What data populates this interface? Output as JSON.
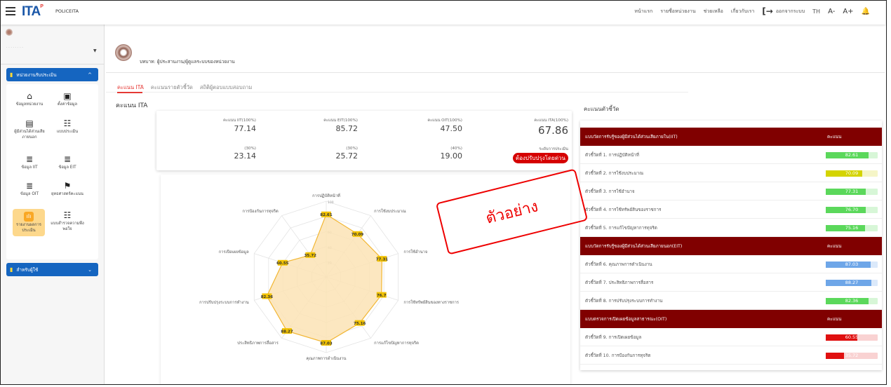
{
  "topbar": {
    "logo": "ITA",
    "logo_sup": "P",
    "brand": "POLICEITA",
    "nav": [
      "หน้าแรก",
      "รายชื่อหน่วยงาน",
      "ช่วยเหลือ",
      "เกี่ยวกับเรา"
    ],
    "login_label": "ออกจากระบบ",
    "login_icon": "logout-icon",
    "lang": "TH",
    "font_minus": "A-",
    "font_plus": "A+",
    "bell_icon": "bell-icon"
  },
  "sidebar": {
    "section1": "หน่วยงานรับประเมิน",
    "section2": "สำหรับผู้ใช้",
    "items": [
      {
        "icon": "home-icon",
        "label": "ข้อมูลหน่วยงาน"
      },
      {
        "icon": "list-check-icon",
        "label": "ตั้งค่าข้อมูล"
      },
      {
        "icon": "stakeholder-icon",
        "label": "ผู้มีส่วนได้ส่วนเสีย ภายนอก"
      },
      {
        "icon": "grid-icon",
        "label": "แบบประเมิน"
      },
      {
        "icon": "list-icon",
        "label": "ข้อมูล IIT"
      },
      {
        "icon": "list-icon",
        "label": "ข้อมูล EIT"
      },
      {
        "icon": "list-icon",
        "label": "ข้อมูล OIT"
      },
      {
        "icon": "flag-icon",
        "label": "ยุทธศาสตร์คะแนน"
      },
      {
        "icon": "report-chart-icon",
        "label": "รายงานผลการประเมิน"
      },
      {
        "icon": "survey-icon",
        "label": "แบบสำรวจความพึงพอใจ"
      }
    ]
  },
  "main": {
    "breadcrumb": "บทบาท: ผู้ประสานงาน/ผู้ดูแลระบบของหน่วยงาน",
    "tabs": [
      "คะแนน ITA",
      "คะแนนรายตัวชี้วัด",
      "สถิติผู้ตอบแบบสอบถาม"
    ],
    "section_label": "คะแนน ITA",
    "scores": {
      "iit_label": "คะแนน IIT(100%)",
      "iit_value": "77.14",
      "eit_label": "คะแนน EIT(100%)",
      "eit_value": "85.72",
      "oit_label": "คะแนน OIT(100%)",
      "oit_value": "47.50",
      "ita_label": "คะแนน ITA(100%)",
      "ita_value": "67.86",
      "iit_w_label": "(30%)",
      "iit_w_value": "23.14",
      "eit_w_label": "(30%)",
      "eit_w_value": "25.72",
      "oit_w_label": "(40%)",
      "oit_w_value": "19.00",
      "level_label": "ระดับการประเมิน",
      "level_value": "ต้องปรับปรุงโดยด่วน"
    },
    "stamp": "ตัวอย่าง"
  },
  "chart_data": {
    "type": "radar",
    "categories": [
      "การปฏิบัติหน้าที่",
      "การใช้งบประมาณ",
      "การใช้อำนาจ",
      "การใช้ทรัพย์สินของทางราชการ",
      "การแก้ไขปัญหาการทุจริต",
      "คุณภาพการดำเนินงาน",
      "ประสิทธิภาพการสื่อสาร",
      "การปรับปรุงระบบการทำงาน",
      "การเปิดเผยข้อมูล",
      "การป้องกันการทุจริต"
    ],
    "values": [
      82.61,
      70.09,
      77.31,
      76.7,
      75.16,
      87.03,
      88.27,
      82.36,
      60.55,
      35.72
    ],
    "value_labels": [
      "82.61",
      "70.09",
      "77.31",
      "76.7",
      "75.16",
      "87.03",
      "88.27",
      "82.36",
      "60.55",
      "35.72"
    ],
    "rmax": 100,
    "ticks": [
      20,
      40,
      60,
      80,
      100
    ],
    "tick_labels": [
      "20",
      "40",
      "60",
      "80",
      "100"
    ],
    "fill_color": "#fbe3b5",
    "line_color": "#f2b632",
    "label_bg": "#f2c200"
  },
  "indicators": {
    "title": "คะแนนตัวชี้วัด",
    "score_header": "คะแนน",
    "groups": [
      {
        "title": "แบบวัดการรับรู้ของผู้มีส่วนได้ส่วนเสียภายใน(IIT)",
        "rows": [
          {
            "label": "ตัวชี้วัดที่ 1. การปฏิบัติหน้าที่",
            "value": "82.61",
            "pct": 82.61,
            "color": "#5bd85b",
            "track": "#d7f6d7"
          },
          {
            "label": "ตัวชี้วัดที่ 2. การใช้งบประมาณ",
            "value": "70.09",
            "pct": 70.09,
            "color": "#d4d400",
            "track": "#f5f5c7"
          },
          {
            "label": "ตัวชี้วัดที่ 3. การใช้อำนาจ",
            "value": "77.31",
            "pct": 77.31,
            "color": "#5bd85b",
            "track": "#d7f6d7"
          },
          {
            "label": "ตัวชี้วัดที่ 4. การใช้ทรัพย์สินของราชการ",
            "value": "76.70",
            "pct": 76.7,
            "color": "#5bd85b",
            "track": "#d7f6d7"
          },
          {
            "label": "ตัวชี้วัดที่ 5. การแก้ไขปัญหาการทุจริต",
            "value": "75.16",
            "pct": 75.16,
            "color": "#5bd85b",
            "track": "#d7f6d7"
          }
        ]
      },
      {
        "title": "แบบวัดการรับรู้ของผู้มีส่วนได้ส่วนเสียภายนอก(EIT)",
        "rows": [
          {
            "label": "ตัวชี้วัดที่ 6. คุณภาพการดำเนินงาน",
            "value": "87.03",
            "pct": 87.03,
            "color": "#6ea6e8",
            "track": "#dbe9fa"
          },
          {
            "label": "ตัวชี้วัดที่ 7. ประสิทธิภาพการสื่อสาร",
            "value": "88.27",
            "pct": 88.27,
            "color": "#6ea6e8",
            "track": "#dbe9fa"
          },
          {
            "label": "ตัวชี้วัดที่ 8. การปรับปรุงระบบการทำงาน",
            "value": "82.36",
            "pct": 82.36,
            "color": "#5bd85b",
            "track": "#d7f6d7"
          }
        ]
      },
      {
        "title": "แบบตรวจการเปิดเผยข้อมูลสาธารณะ(OIT)",
        "rows": [
          {
            "label": "ตัวชี้วัดที่ 9. การเปิดเผยข้อมูล",
            "value": "60.55",
            "pct": 60.55,
            "color": "#e01010",
            "track": "#f9d2d2"
          },
          {
            "label": "ตัวชี้วัดที่ 10. การป้องกันการทุจริต",
            "value": "35.72",
            "pct": 35.72,
            "color": "#e01010",
            "track": "#f9d2d2"
          }
        ]
      }
    ]
  }
}
